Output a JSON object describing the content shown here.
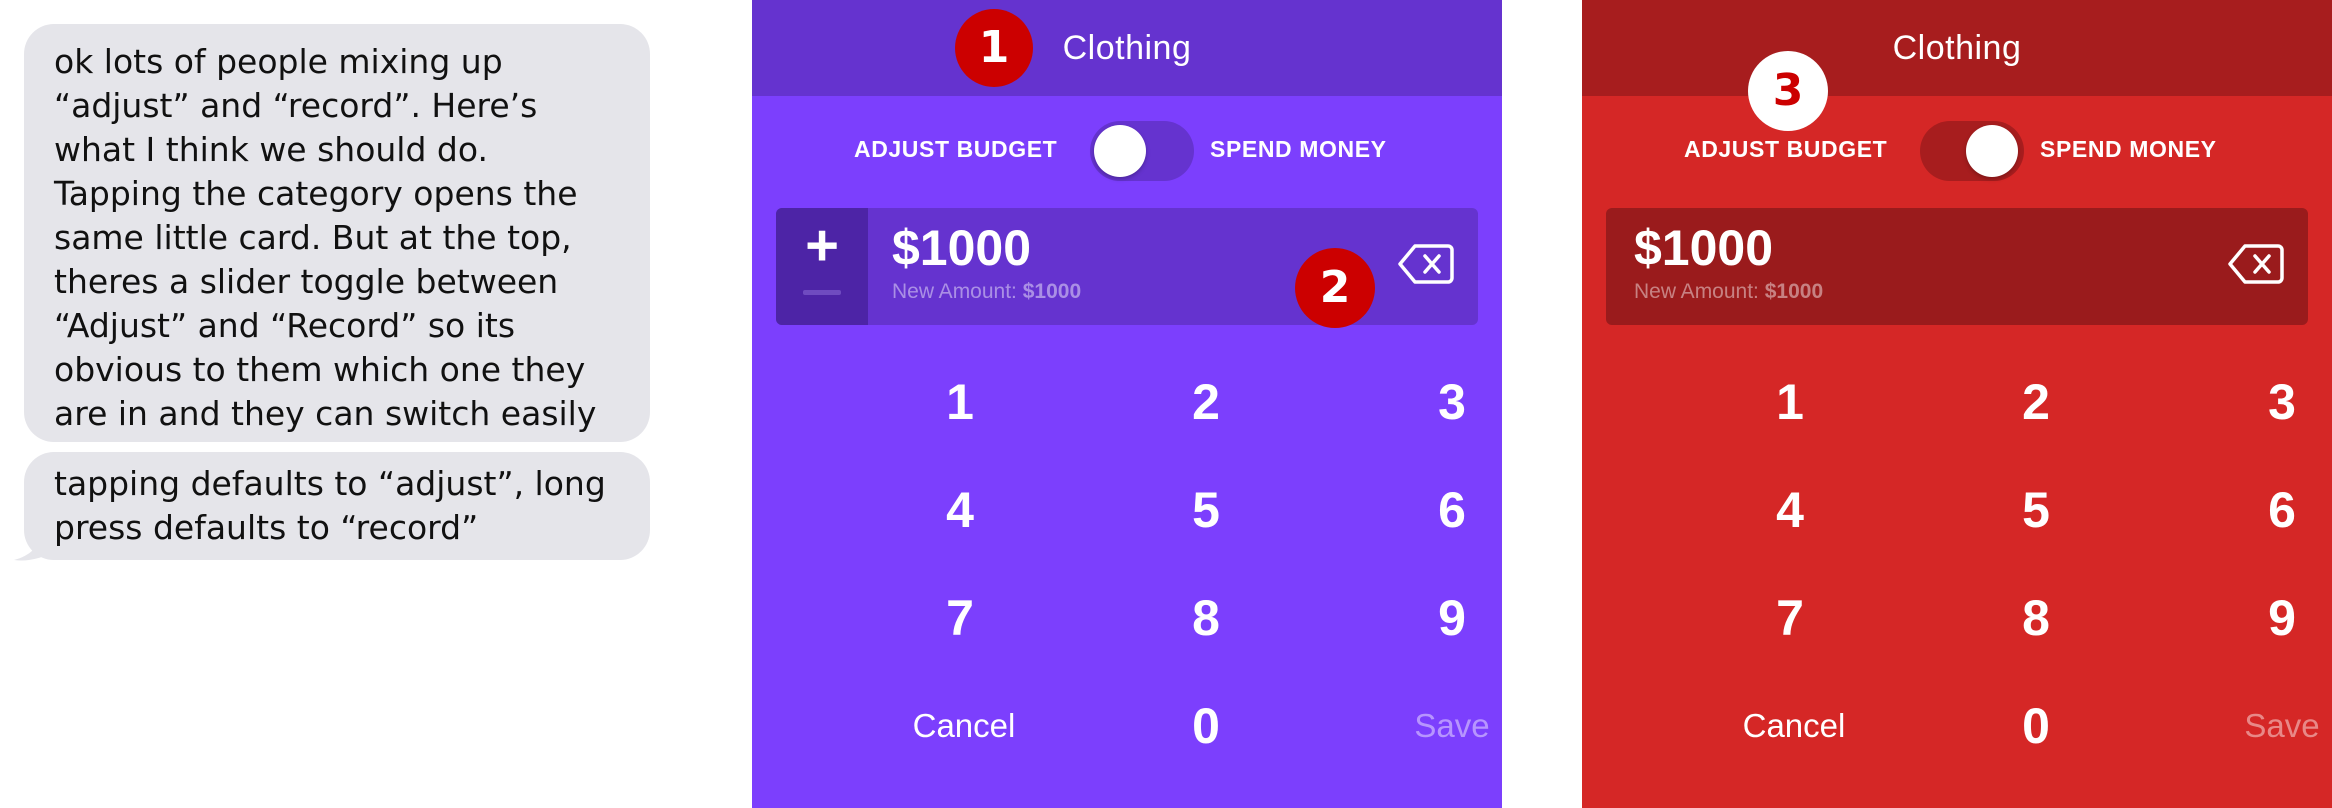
{
  "chat": {
    "bubble1_lines": [
      "ok lots of people mixing up",
      "“adjust” and “record”. Here’s",
      "what I think we should do.",
      "Tapping the category opens the",
      "same little card. But at the top,",
      "theres a slider toggle between",
      "“Adjust” and “Record” so its",
      "obvious to them which one they",
      "are in and they can switch easily"
    ],
    "bubble2_lines": [
      "tapping defaults to “adjust”, long",
      "press defaults to “record”"
    ],
    "bubble_color": "#e5e5ea"
  },
  "panel_purple": {
    "title": "Clothing",
    "toggle_left": "ADJUST BUDGET",
    "toggle_right": "SPEND MONEY",
    "toggle_state": "adjust",
    "amount": "$1000",
    "new_amount_label": "New Amount:",
    "new_amount_value": "$1000",
    "sign_plus": "+",
    "keys": [
      "1",
      "2",
      "3",
      "4",
      "5",
      "6",
      "7",
      "8",
      "9"
    ],
    "cancel": "Cancel",
    "zero": "0",
    "save": "Save",
    "colors": {
      "background": "#7c3ffd",
      "header": "#6533cf"
    },
    "markers": [
      "1",
      "2"
    ]
  },
  "panel_red": {
    "title": "Clothing",
    "toggle_left": "ADJUST BUDGET",
    "toggle_right": "SPEND MONEY",
    "toggle_state": "spend",
    "amount": "$1000",
    "new_amount_label": "New Amount:",
    "new_amount_value": "$1000",
    "keys": [
      "1",
      "2",
      "3",
      "4",
      "5",
      "6",
      "7",
      "8",
      "9"
    ],
    "cancel": "Cancel",
    "zero": "0",
    "save": "Save",
    "colors": {
      "background": "#d52726",
      "header": "#a71d1e"
    },
    "markers": [
      "3"
    ]
  }
}
